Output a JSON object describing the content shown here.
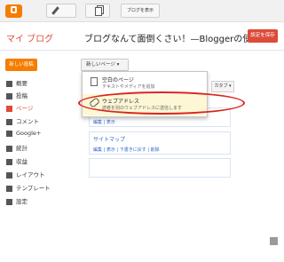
{
  "topbar": {
    "view_blog_label": "ブログを表示"
  },
  "header": {
    "my_blog": "マイ ブログ",
    "blog_title": "ブログなんて面倒くさい！—Bloggerの使",
    "settings_label": "設定を保存"
  },
  "sidebar": {
    "new_post_label": "新しい投稿",
    "items": [
      {
        "label": "概要",
        "icon": "home-icon"
      },
      {
        "label": "投稿",
        "icon": "posts-icon"
      },
      {
        "label": "ページ",
        "icon": "pages-icon",
        "active": true
      },
      {
        "label": "コメント",
        "icon": "comments-icon"
      },
      {
        "label": "Google+",
        "icon": "google-plus-icon"
      },
      {
        "label": "統計",
        "icon": "stats-icon"
      },
      {
        "label": "収益",
        "icon": "earnings-icon"
      },
      {
        "label": "レイアウト",
        "icon": "layout-icon"
      },
      {
        "label": "テンプレート",
        "icon": "template-icon"
      },
      {
        "label": "設定",
        "icon": "settings-icon"
      }
    ]
  },
  "main": {
    "new_page_label": "新しいページ ▾",
    "tab_label": "カタブ ▾",
    "rows": [
      {
        "actions": "編集 | 表示"
      },
      {
        "title": "サイトマップ",
        "actions": "編集 | 表示 | 下書きに戻す | 削除"
      }
    ]
  },
  "dropdown": {
    "items": [
      {
        "title": "空白のページ",
        "desc": "テキストやメディアを追加"
      },
      {
        "title": "ウェブアドレス",
        "desc": "読者を別のウェブアドレスに送信します"
      }
    ]
  },
  "colors": {
    "accent_orange": "#f57d00",
    "accent_red": "#dd4b39",
    "annotation_red": "#d8251d"
  }
}
